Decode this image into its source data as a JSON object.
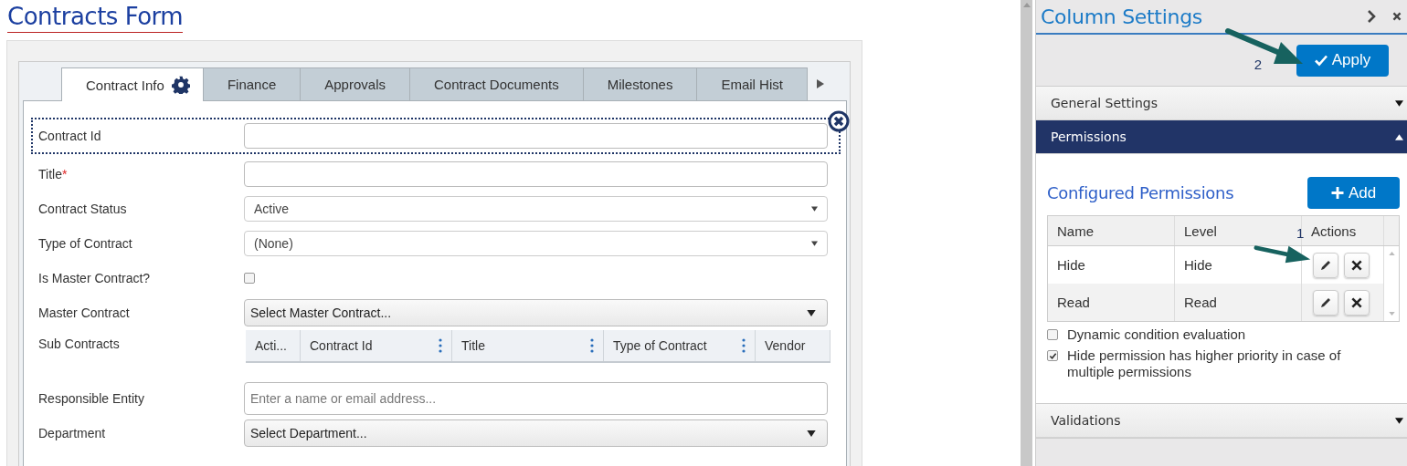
{
  "page_title": "Contracts Form",
  "tabs": [
    {
      "label": "Contract Info",
      "selected": true,
      "settings_icon": true
    },
    {
      "label": "Finance",
      "selected": false,
      "settings_icon": false
    },
    {
      "label": "Approvals",
      "selected": false,
      "settings_icon": false
    },
    {
      "label": "Contract Documents",
      "selected": false,
      "settings_icon": false
    },
    {
      "label": "Milestones",
      "selected": false,
      "settings_icon": false
    },
    {
      "label": "Email Hist",
      "selected": false,
      "settings_icon": false
    }
  ],
  "fields": [
    {
      "kind": "text",
      "label": "Contract Id",
      "focused": true
    },
    {
      "kind": "text",
      "label": "Title",
      "required_mark": "*",
      "focused": false
    },
    {
      "kind": "select",
      "label": "Contract Status",
      "value": "Active"
    },
    {
      "kind": "select",
      "label": "Type of Contract",
      "value": "(None)"
    },
    {
      "kind": "checkbox",
      "label": "Is Master Contract?",
      "checked": false
    },
    {
      "kind": "combo",
      "label": "Master Contract",
      "value": "Select Master Contract..."
    },
    {
      "kind": "grid",
      "label": "Sub Contracts",
      "columns": [
        {
          "label": "Acti...",
          "menu": false
        },
        {
          "label": "Contract Id",
          "menu": true
        },
        {
          "label": "Title",
          "menu": true
        },
        {
          "label": "Type of Contract",
          "menu": true
        },
        {
          "label": "Vendor",
          "menu": false
        }
      ]
    },
    {
      "kind": "people",
      "label": "Responsible Entity",
      "placeholder": "Enter a name or email address..."
    },
    {
      "kind": "combo",
      "label": "Department",
      "value": "Select Department..."
    }
  ],
  "panel": {
    "title": "Column Settings",
    "annotation": "2",
    "apply_label": "Apply",
    "sections": [
      {
        "label": "General Settings",
        "expanded": false
      },
      {
        "label": "Permissions",
        "expanded": true
      },
      {
        "label": "Validations",
        "expanded": false
      }
    ],
    "permissions": {
      "heading": "Configured Permissions",
      "add_label": "Add",
      "annotation": "1",
      "columns": [
        "Name",
        "Level",
        "Actions"
      ],
      "rows": [
        {
          "name": "Hide",
          "level": "Hide"
        },
        {
          "name": "Read",
          "level": "Read"
        }
      ],
      "options": [
        {
          "label": "Dynamic condition evaluation",
          "checked": false
        },
        {
          "label": "Hide permission has higher priority in case of multiple permissions",
          "checked": true
        }
      ]
    }
  }
}
